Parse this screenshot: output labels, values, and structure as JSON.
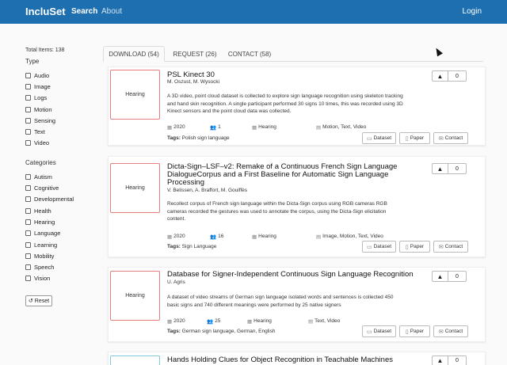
{
  "navbar": {
    "brand": "IncluSet",
    "search": "Search",
    "about": "About",
    "login": "Login"
  },
  "sidebar": {
    "total": "Total Items: 138",
    "type_title": "Type",
    "types": [
      "Audio",
      "Image",
      "Logs",
      "Motion",
      "Sensing",
      "Text",
      "Video"
    ],
    "categories_title": "Categories",
    "categories": [
      "Autism",
      "Cognitive",
      "Developmental",
      "Health",
      "Hearing",
      "Language",
      "Learning",
      "Mobility",
      "Speech",
      "Vision"
    ],
    "reset": "Reset"
  },
  "tabs": [
    "DOWNLOAD (54)",
    "REQUEST (26)",
    "CONTACT (58)"
  ],
  "buttons": {
    "dataset": "Dataset",
    "paper": "Paper",
    "contact": "Contact"
  },
  "cards": [
    {
      "thumb": "Hearing",
      "title": "PSL Kinect 30",
      "authors": "M. Oszust, M. Wysocki",
      "description": "A 3D video, point cloud dataset is collected to explore sign language recognition using skeleton tracking and hand skin recognition. A single participant performed 30 signs 10 times, this was recorded using 3D Kinect sensors and the point cloud data was collected.",
      "year": "2020",
      "participants": "1",
      "category": "Hearing",
      "types": "Motion, Text, Video",
      "tags_label": "Tags:",
      "tags": "Polish sign language",
      "votes": "0"
    },
    {
      "thumb": "Hearing",
      "title_line1": "Dicta-Sign–LSF–v2: Remake of a Continuous French Sign Language",
      "title_line2": "DialogueCorpus and a First Baseline for Automatic Sign Language",
      "title_line3": "Processing",
      "authors": "V. Belissen, A. Braffort, M. Gouiffès",
      "description": "Recollect corpus of French sign language within the Dicta-Sign corpus using RGB cameras RGB cameras recorded the gestures was used to annotate the corpus, using the Dicta-Sign elicitation content.",
      "year": "2020",
      "participants": "16",
      "category": "Hearing",
      "types": "Image, Motion, Text, Video",
      "tags_label": "Tags:",
      "tags": "Sign Language",
      "votes": "0"
    },
    {
      "thumb": "Hearing",
      "title": "Database for Signer-Independent Continuous Sign Language Recognition",
      "authors": "U. Agris",
      "description": "A dataset of video streams of German sign language isolated words and sentences is collected 450 basic signs and 740 different meanings were performed by 25 native signers",
      "year": "2020",
      "participants": "25",
      "category": "Hearing",
      "types": "Text, Video",
      "tags_label": "Tags:",
      "tags": "German sign language, German, English",
      "votes": "0"
    },
    {
      "title": "Hands Holding Clues for Object Recognition in Teachable Machines",
      "votes": "0"
    }
  ]
}
